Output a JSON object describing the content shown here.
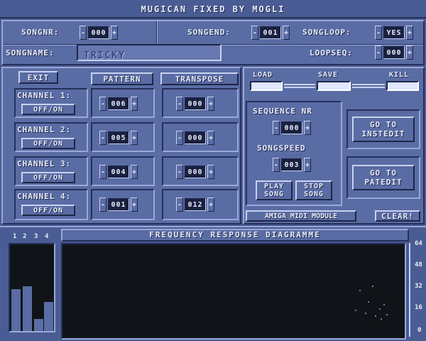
{
  "window": {
    "title": "MUGICAN FIXED BY MOGLI"
  },
  "song": {
    "songnr_label": "SONGNR:",
    "songnr_value": "000",
    "songend_label": "SONGEND:",
    "songend_value": "001",
    "songloop_label": "SONGLOOP:",
    "songloop_value": "YES",
    "songname_label": "SONGNAME:",
    "songname_value": "TRICKY",
    "loopseq_label": "LOOPSEQ:",
    "loopseq_value": "000"
  },
  "controls": {
    "exit_label": "EXIT",
    "pattern_header": "PATTERN",
    "transpose_header": "TRANSPOSE",
    "minus": "-",
    "plus": "+"
  },
  "channels": [
    {
      "label": "CHANNEL 1:",
      "toggle": "OFF/ON",
      "pattern": "006",
      "transpose": "000"
    },
    {
      "label": "CHANNEL 2:",
      "toggle": "OFF/ON",
      "pattern": "005",
      "transpose": "000"
    },
    {
      "label": "CHANNEL 3:",
      "toggle": "OFF/ON",
      "pattern": "004",
      "transpose": "000"
    },
    {
      "label": "CHANNEL 4:",
      "toggle": "OFF/ON",
      "pattern": "001",
      "transpose": "012"
    }
  ],
  "file": {
    "load_label": "LOAD",
    "save_label": "SAVE",
    "kill_label": "KILL"
  },
  "sequence": {
    "sequence_label": "SEQUENCE NR",
    "sequence_value": "000",
    "speed_label": "SONGSPEED",
    "speed_value": "003",
    "play_label_1": "PLAY",
    "play_label_2": "SONG",
    "stop_label_1": "STOP",
    "stop_label_2": "SONG"
  },
  "goto": {
    "instedit_1": "GO TO",
    "instedit_2": "INSTEDIT",
    "patedit_1": "GO TO",
    "patedit_2": "PATEDIT"
  },
  "footer": {
    "midi_label": "AMIGA MIDI MODULE",
    "clear_label": "CLEAR!"
  },
  "vu": {
    "labels": [
      "1",
      "2",
      "3",
      "4"
    ],
    "levels": [
      0.48,
      0.52,
      0.14,
      0.34
    ]
  },
  "frequency": {
    "title": "FREQUENCY RESPONSE DIAGRAMME",
    "scale": [
      "64",
      "48",
      "32",
      "16",
      "0"
    ]
  },
  "colors": {
    "background": "#4a5c94",
    "panel": "#5a6ca4",
    "display": "#101418",
    "vu_bar": "#5a6ca4",
    "text": "#e8ecf8"
  }
}
